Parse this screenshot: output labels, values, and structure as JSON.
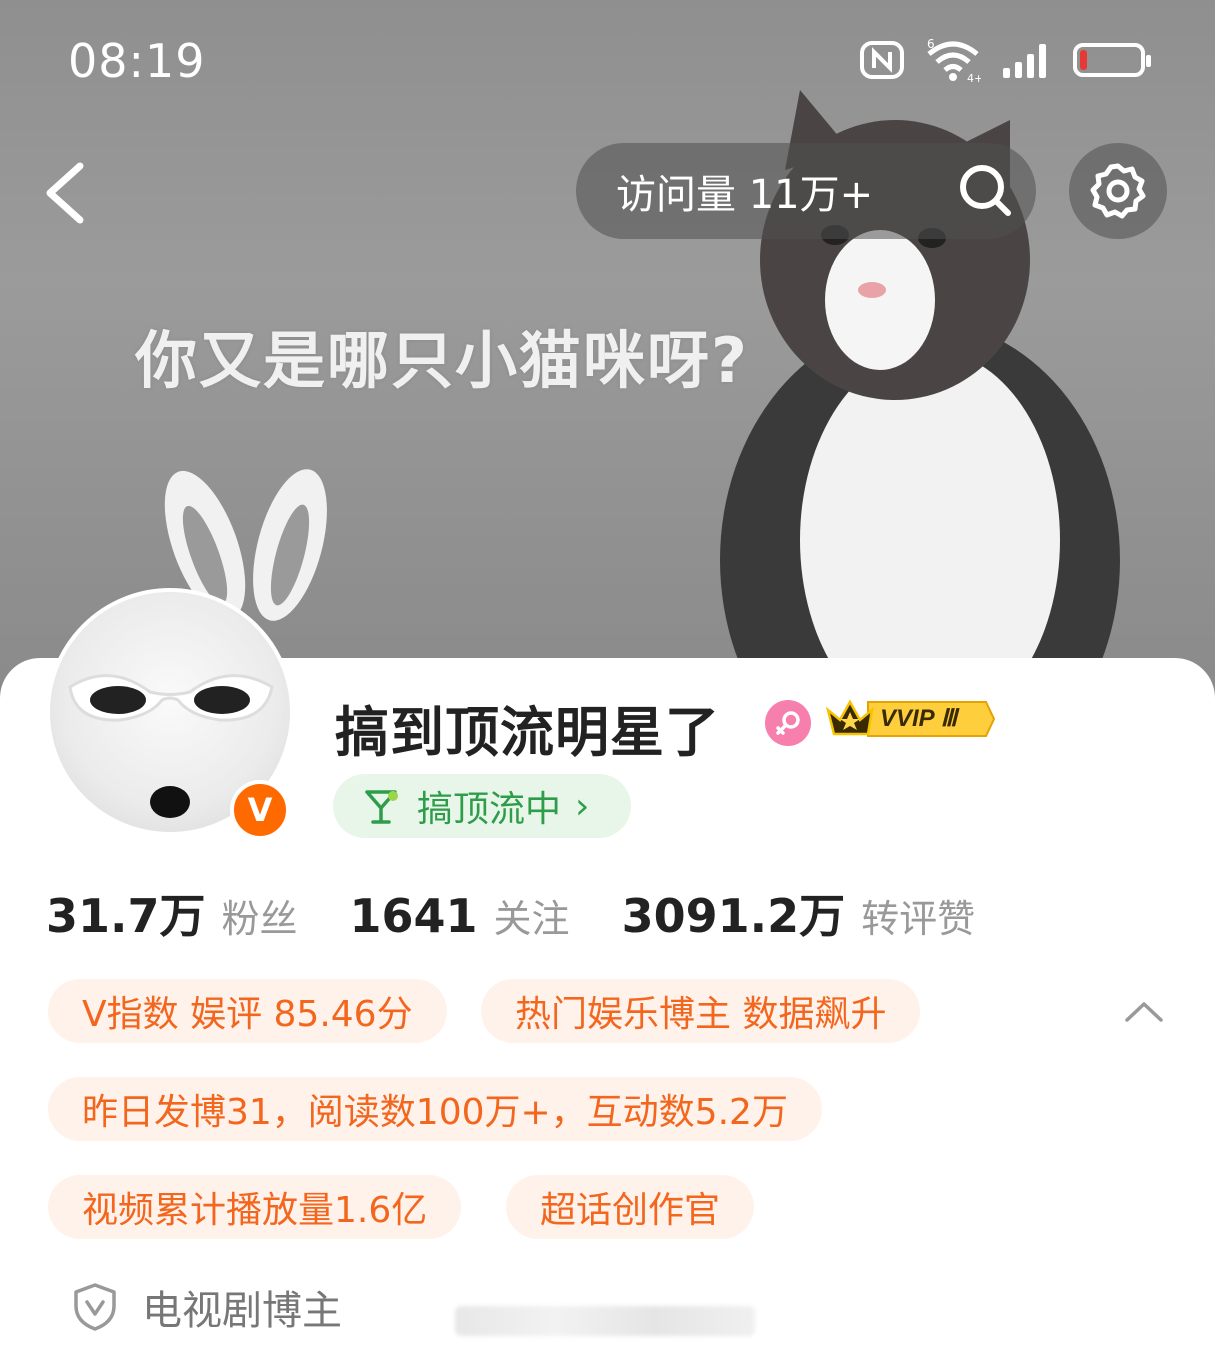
{
  "status_bar": {
    "time": "08:19",
    "signal_badge": "6",
    "net_badge": "4+"
  },
  "header": {
    "visit_label": "访问量 11万+"
  },
  "cover": {
    "text": "你又是哪只小猫咪呀?"
  },
  "profile": {
    "name": "搞到顶流明星了",
    "vip_label": "VVIP Ⅲ",
    "status_text": "搞顶流中",
    "status_chevron": "›",
    "verified_letter": "V"
  },
  "stats": [
    {
      "num": "31.7万",
      "label": "粉丝"
    },
    {
      "num": "1641",
      "label": "关注"
    },
    {
      "num": "3091.2万",
      "label": "转评赞"
    }
  ],
  "tags": [
    "V指数 娱评 85.46分",
    "热门娱乐博主 数据飙升",
    "昨日发博31，阅读数100万+，互动数5.2万",
    "视频累计播放量1.6亿",
    "超话创作官"
  ],
  "verification": {
    "text": "电视剧博主"
  },
  "colors": {
    "accent": "#f3661e",
    "tag_bg": "#fff2ea",
    "status_green": "#2e9d4a"
  }
}
